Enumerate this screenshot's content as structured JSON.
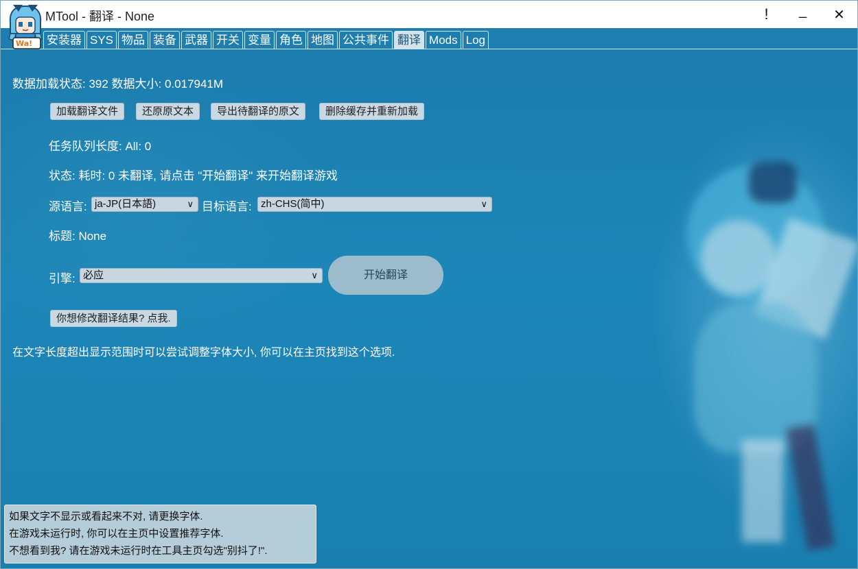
{
  "window": {
    "title": "MTool - 翻译 - None",
    "controls": {
      "alert": "!",
      "minimize": "_",
      "close": "✕"
    }
  },
  "logo": {
    "badge": "Wa!"
  },
  "tabs": [
    {
      "label": "安装器",
      "active": false
    },
    {
      "label": "SYS",
      "active": false
    },
    {
      "label": "物品",
      "active": false
    },
    {
      "label": "装备",
      "active": false
    },
    {
      "label": "武器",
      "active": false
    },
    {
      "label": "开关",
      "active": false
    },
    {
      "label": "变量",
      "active": false
    },
    {
      "label": "角色",
      "active": false
    },
    {
      "label": "地图",
      "active": false
    },
    {
      "label": "公共事件",
      "active": false
    },
    {
      "label": "翻译",
      "active": true
    },
    {
      "label": "Mods",
      "active": false
    },
    {
      "label": "Log",
      "active": false
    }
  ],
  "main": {
    "data_status": "数据加载状态: 392 数据大小: 0.017941M",
    "buttons": {
      "load": "加载翻译文件",
      "restore": "还原原文本",
      "export": "导出待翻译的原文",
      "clear_reload": "删除缓存并重新加载"
    },
    "queue_length": "任务队列长度: All: 0",
    "status": "状态: 耗时: 0 未翻译, 请点击 \"开始翻译\" 来开始翻译游戏",
    "source_lang_label": "源语言:",
    "source_lang_value": "ja-JP(日本語)",
    "target_lang_label": "目标语言:",
    "target_lang_value": "zh-CHS(简中)",
    "title_line": "标题: None",
    "engine_label": "引擎:",
    "engine_value": "必应",
    "start_button": "开始翻译",
    "modify_button": "你想修改翻译结果? 点我.",
    "hint": "在文字长度超出显示范围时可以尝试调整字体大小, 你可以在主页找到这个选项."
  },
  "tooltip": {
    "line1": "如果文字不显示或看起来不对, 请更换字体.",
    "line2": "在游戏未运行时, 你可以在主页中设置推荐字体.",
    "line3": "不想看到我? 请在游戏未运行时在工具主页勾选\"别抖了!\"."
  }
}
